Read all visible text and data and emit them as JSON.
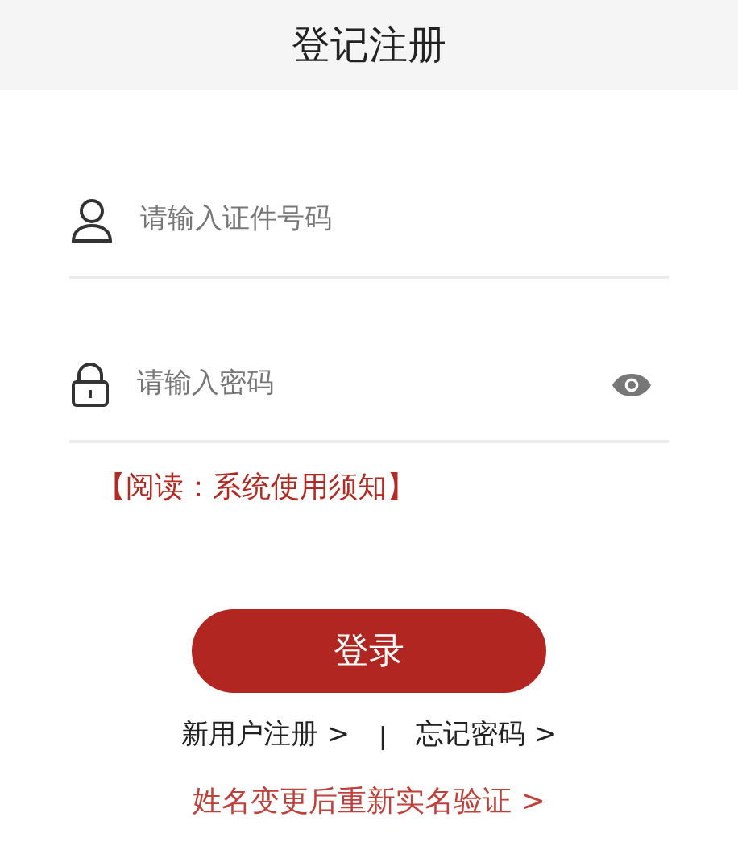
{
  "header": {
    "title": "登记注册"
  },
  "fields": [
    {
      "kind": "id",
      "placeholder": "请输入证件号码"
    },
    {
      "kind": "password",
      "placeholder": "请输入密码"
    }
  ],
  "notice_link": "【阅读：系统使用须知】",
  "login_button": "登录",
  "links": [
    {
      "label": "新用户注册 >"
    },
    {
      "label": "忘记密码 >"
    }
  ],
  "separator": "|",
  "verify_link": "姓名变更后重新实名验证 >"
}
